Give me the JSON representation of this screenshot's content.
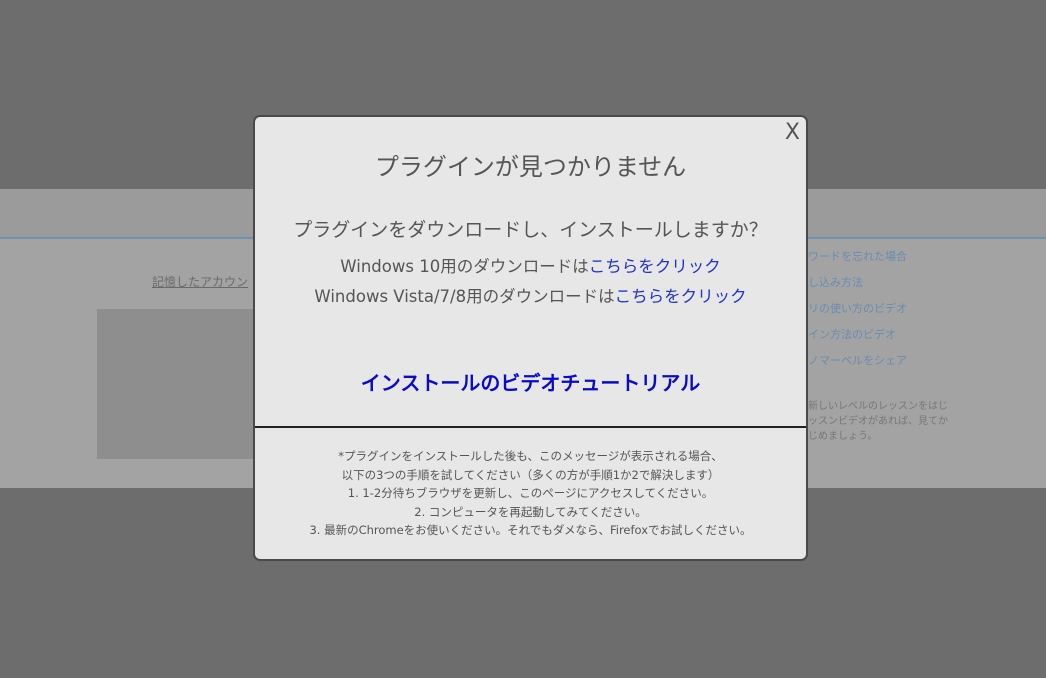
{
  "background": {
    "remember_account": "記憶したアカウン",
    "side_links": [
      "ワードを忘れた場合",
      "し込み方法",
      "リの使い方のビデオ",
      "イン方法のビデオ",
      "ノマーベルをシェア"
    ],
    "side_note": [
      "新しいレベルのレッスンをはじ",
      "ッスンビデオがあれば、見てか",
      "じめましょう。"
    ]
  },
  "modal": {
    "close_label": "X",
    "title": "プラグインが見つかりません",
    "question": "プラグインをダウンロードし、インストールしますか？",
    "win10_text": "Windows 10用のダウンロードは",
    "win10_link": "こちらをクリック",
    "win78_text": "Windows Vista/7/8用のダウンロードは",
    "win78_link": "こちらをクリック",
    "video_tutorial": "インストールのビデオチュートリアル",
    "notes": [
      "*プラグインをインストールした後も、このメッセージが表示される場合、",
      "以下の3つの手順を試してください（多くの方が手順1か2で解決します）",
      "1. 1-2分待ちブラウザを更新し、このページにアクセスしてください。",
      "2. コンピュータを再起動してみてください。",
      "3. 最新のChromeをお使いください。それでもダメなら、Firefoxでお試しください。"
    ]
  }
}
